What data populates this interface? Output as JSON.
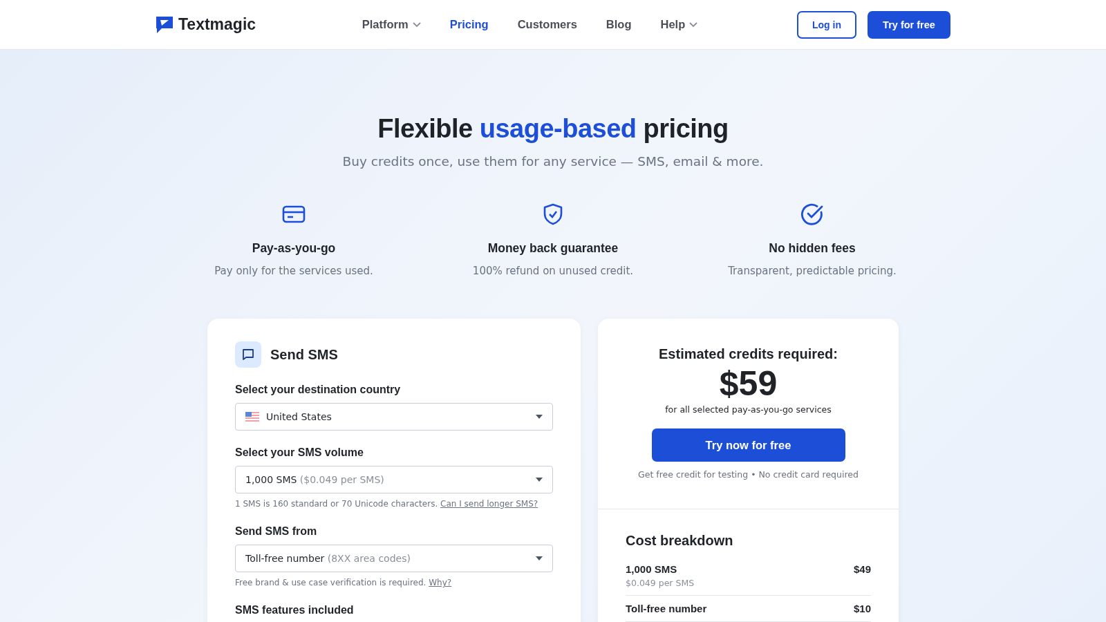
{
  "header": {
    "logo": "Textmagic",
    "nav": [
      {
        "label": "Platform",
        "selected": false,
        "has_menu": true
      },
      {
        "label": "Pricing",
        "selected": true,
        "has_menu": false
      },
      {
        "label": "Customers",
        "selected": false,
        "has_menu": false
      },
      {
        "label": "Blog",
        "selected": false,
        "has_menu": false
      },
      {
        "label": "Help",
        "selected": false,
        "has_menu": true
      }
    ],
    "login": "Log in",
    "cta": "Try for free"
  },
  "hero": {
    "title_parts": [
      {
        "text": "Flexible ",
        "highlight": false
      },
      {
        "text": "usage-based",
        "highlight": true
      },
      {
        "text": " pricing",
        "highlight": false
      }
    ],
    "subtitle": "Buy credits once, use them for any service — SMS, email & more."
  },
  "features": [
    {
      "title": "Pay-as-you-go",
      "text": "Pay only for the services used."
    },
    {
      "title": "Money back guarantee",
      "text": "100% refund on unused credit."
    },
    {
      "title": "No hidden fees",
      "text": "Transparent, predictable pricing."
    }
  ],
  "calculator": {
    "title": "Send SMS",
    "fields": [
      {
        "label": "Select your destination country",
        "value": "United States",
        "flag": true
      },
      {
        "label": "Select your SMS volume",
        "value": "1,000 SMS",
        "note": "($0.049 per SMS)",
        "flag": false,
        "hint": "1 SMS is 160 standard or 70 Unicode characters.",
        "hint_link": "Can I send longer SMS?"
      },
      {
        "label": "Send SMS from",
        "value": "Toll-free number",
        "note": "(8XX area codes)",
        "flag": false,
        "hint": "Free brand & use case verification is required.",
        "hint_link": "Why?"
      }
    ],
    "section": "SMS features included"
  },
  "summary": {
    "heading": "Estimated credits required:",
    "amount": "$59",
    "amount_note": "for all selected pay-as-you-go services",
    "button": "Try now for free",
    "note": "Get free credit for testing • No credit card required",
    "breakdown_title": "Cost breakdown",
    "items": [
      {
        "name": "1,000 SMS",
        "price": "$49",
        "detail": "$0.049 per SMS"
      },
      {
        "name": "Toll-free number",
        "price": "$10"
      }
    ]
  }
}
